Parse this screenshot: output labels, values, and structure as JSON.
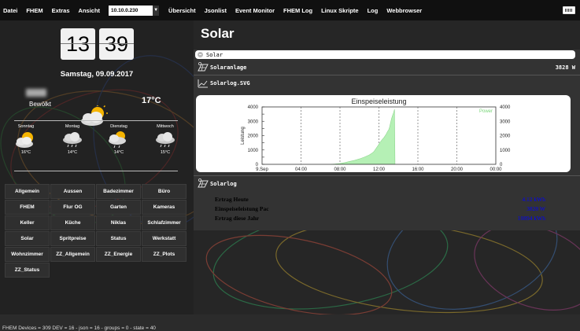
{
  "topbar": {
    "menu": [
      "Datei",
      "FHEM",
      "Extras",
      "Ansicht"
    ],
    "ip_select_value": "10.10.0.230",
    "menu2": [
      "Übersicht",
      "Jsonlist",
      "Event Monitor",
      "FHEM Log",
      "Linux Skripte",
      "Log",
      "Webbrowser"
    ],
    "keyboard_icon": "keyboard-icon"
  },
  "clock": {
    "hours": "13",
    "minutes": "39",
    "date": "Samstag, 09.09.2017"
  },
  "weather": {
    "condition": "Bewölkt",
    "temperature": "17°C",
    "icon": "partly-cloudy-icon",
    "forecast": [
      {
        "day": "Sonntag",
        "temp": "16°C",
        "icon": "partly-cloudy-icon"
      },
      {
        "day": "Montag",
        "temp": "14°C",
        "icon": "rain-cloud-icon"
      },
      {
        "day": "Dienstag",
        "temp": "14°C",
        "icon": "sun-rain-icon"
      },
      {
        "day": "Mittwoch",
        "temp": "15°C",
        "icon": "rain-cloud-icon"
      }
    ]
  },
  "rooms": [
    "Allgemein",
    "Aussen",
    "Badezimmer",
    "Büro",
    "FHEM",
    "Flur OG",
    "Garten",
    "Kameras",
    "Keller",
    "Küche",
    "Niklas",
    "Schlafzimmer",
    "Solar",
    "Spritpreise",
    "Status",
    "Werkstatt",
    "Wohnzimmer",
    "ZZ_Allgemein",
    "ZZ_Energie",
    "ZZ_Plots",
    "ZZ_Status"
  ],
  "footer": "FHEM Devices = 309   DEV = 16 - json = 16 - groups = 0 - state = 40",
  "page_title": "Solar",
  "panel": {
    "header": "Solar",
    "solaranlage_label": "Solaranlage",
    "solaranlage_value": "3828 W",
    "svg_label": "Solarlog.SVG",
    "solarlog_label": "Solarlog",
    "solarlog_rows": [
      {
        "label": "Ertrag Heute",
        "value": "4.12 kWh"
      },
      {
        "label": "Einspeiseleistung Pac",
        "value": "3828 W"
      },
      {
        "label": "Ertrag diese Jahr",
        "value": "10894 kWh"
      }
    ]
  },
  "colors": {
    "fill": "#b5f0b5",
    "line": "#8fd68f",
    "legend": "#79d679",
    "value_blue": "#0000ff"
  },
  "chart_data": {
    "type": "area",
    "title": "Einspeiseleistung",
    "ylabel": "Leistung",
    "legend": "Power",
    "legend_position": "top-right",
    "x_ticks": [
      "9.Sep",
      "04:00",
      "08:00",
      "12:00",
      "16:00",
      "20:00",
      "00:00"
    ],
    "y_ticks": [
      "0",
      "500",
      "1000",
      "1500",
      "2000",
      "2500",
      "3000",
      "3500",
      "4000"
    ],
    "y2_ticks": [
      "0",
      "1000",
      "2000",
      "3000",
      "4000"
    ],
    "xlim_hours": [
      0,
      24
    ],
    "ylim": [
      0,
      4000
    ],
    "series": [
      {
        "name": "Power",
        "x_hours": [
          7.0,
          7.5,
          8.0,
          8.5,
          9.0,
          9.5,
          10.0,
          10.5,
          11.0,
          11.3,
          11.5,
          11.7,
          11.9,
          12.1,
          12.3,
          12.5,
          12.7,
          12.9,
          13.0,
          13.1,
          13.2,
          13.3,
          13.4,
          13.5,
          13.6,
          13.65
        ],
        "values": [
          0,
          20,
          60,
          120,
          200,
          280,
          380,
          500,
          650,
          780,
          900,
          1100,
          1300,
          1500,
          1700,
          1850,
          2050,
          2300,
          2400,
          2600,
          2900,
          3200,
          3400,
          3600,
          3828,
          0
        ]
      }
    ]
  }
}
